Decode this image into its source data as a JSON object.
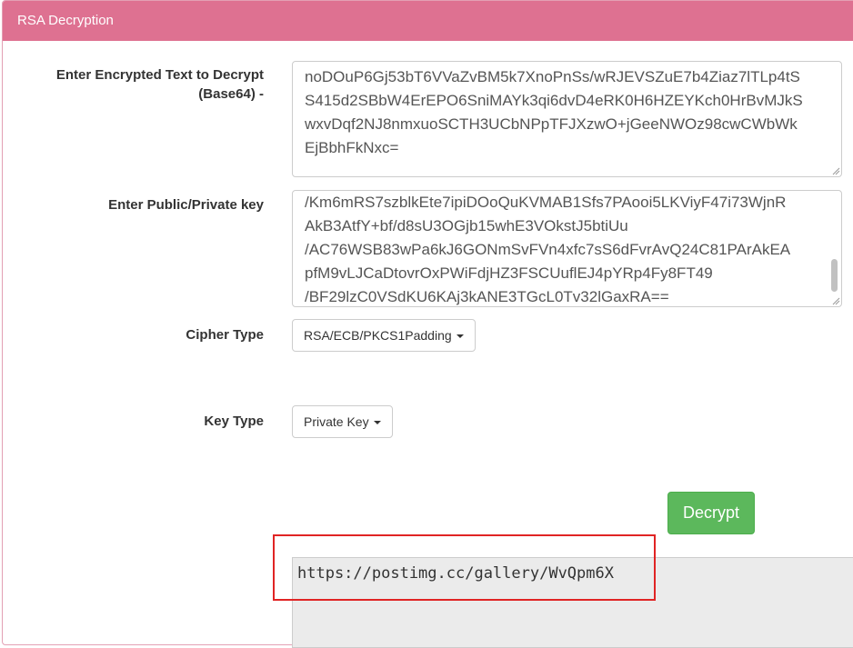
{
  "panel": {
    "title": "RSA Decryption"
  },
  "encrypted": {
    "label_line1": "Enter Encrypted Text to Decrypt",
    "label_line2": "(Base64) -",
    "lines": [
      "noDOuP6Gj53bT6VVaZvBM5k7XnoPnSs/wRJEVSZuE7b4Ziaz7lTLp4tS",
      "S415d2SBbW4ErEPO6SniMAYk3qi6dvD4eRK0H6HZEYKch0HrBvMJkS",
      "wxvDqf2NJ8nmxuoSCTH3UCbNPpTFJXzwO+jGeeNWOz98cwCWbWk",
      "EjBbhFkNxc="
    ]
  },
  "key": {
    "label": "Enter Public/Private key",
    "lines": [
      "/Km6mRS7szblkEte7ipiDOoQuKVMAB1Sfs7PAooi5LKViyF47i73WjnR",
      "AkB3AtfY+bf/d8sU3OGjb15whE3VOkstJ5btiUu",
      "/AC76WSB83wPa6kJ6GONmSvFVn4xfc7sS6dFvrAvQ24C81PArAkEA",
      "pfM9vLJCaDtovrOxPWiFdjHZ3FSCUuflEJ4pYRp4Fy8FT49",
      "/BF29lzC0VSdKU6KAj3kANE3TGcL0Tv32lGaxRA=="
    ]
  },
  "cipher": {
    "label": "Cipher Type",
    "selected": "RSA/ECB/PKCS1Padding"
  },
  "keytype": {
    "label": "Key Type",
    "selected": "Private Key"
  },
  "actions": {
    "decrypt_label": "Decrypt"
  },
  "output": {
    "text": "https://postimg.cc/gallery/WvQpm6X"
  },
  "colors": {
    "heading": "#de7191",
    "decrypt": "#5cb85c",
    "highlight": "#e02424"
  }
}
